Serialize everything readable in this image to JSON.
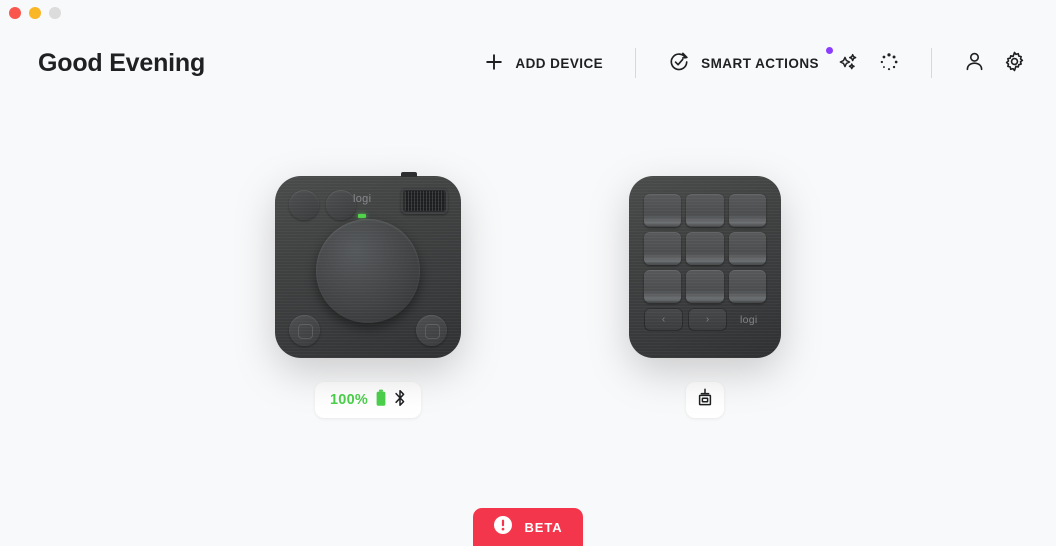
{
  "window": {
    "traffic_lights": [
      {
        "name": "close",
        "color": "#f9574e"
      },
      {
        "name": "minimize",
        "color": "#f9b626"
      },
      {
        "name": "zoom",
        "color": "#dcdcdc"
      }
    ]
  },
  "header": {
    "greeting": "Good Evening",
    "add_device": {
      "label": "ADD DEVICE",
      "icon": "plus-icon"
    },
    "smart_actions": {
      "label": "SMART ACTIONS",
      "icon": "circular-arrow-check-icon",
      "has_notification": true,
      "notification_color": "#8b3dff"
    },
    "icons": [
      {
        "name": "sparkles-icon"
      },
      {
        "name": "loading-dots-icon"
      },
      {
        "name": "account-icon"
      },
      {
        "name": "settings-gear-icon"
      }
    ]
  },
  "devices": [
    {
      "name": "mx-creative-console-dialpad",
      "logo_text": "logi",
      "status": {
        "battery_percent": "100%",
        "battery_color": "#4cd04c",
        "icons": [
          "battery-icon",
          "bluetooth-icon"
        ]
      }
    },
    {
      "name": "mx-creative-keypad",
      "logo_text": "logi",
      "nav_prev": "‹",
      "nav_next": "›",
      "status": {
        "icons": [
          "usb-receiver-icon"
        ]
      }
    }
  ],
  "beta": {
    "label": "BETA",
    "icon": "alert-circle-icon",
    "background": "#f4364c"
  }
}
